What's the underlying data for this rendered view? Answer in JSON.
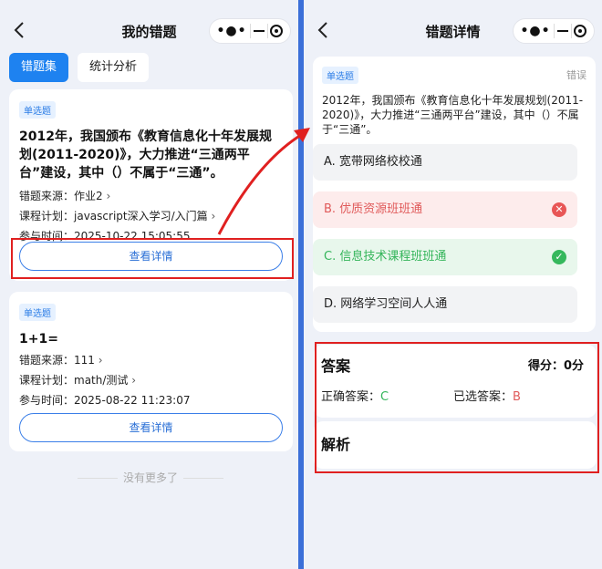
{
  "left": {
    "nav_title": "我的错题",
    "tabs": [
      "错题集",
      "统计分析"
    ],
    "cards": [
      {
        "badge": "单选题",
        "title": "2012年，我国颁布《教育信息化十年发展规划(2011-2020)》，大力推进“三通两平台”建设，其中（）不属于“三通”。",
        "source_label": "错题来源：",
        "source": "作业2",
        "plan_label": "课程计划：",
        "plan": "javascript深入学习/入门篇",
        "time_label": "参与时间：",
        "time": "2025-10-22 15:05:55",
        "button": "查看详情"
      },
      {
        "badge": "单选题",
        "title": "1+1=",
        "source_label": "错题来源：",
        "source": "111",
        "plan_label": "课程计划：",
        "plan": "math/测试",
        "time_label": "参与时间：",
        "time": "2025-08-22 11:23:07",
        "button": "查看详情"
      }
    ],
    "no_more": "没有更多了"
  },
  "right": {
    "nav_title": "错题详情",
    "badge": "单选题",
    "status": "错误",
    "stem": "2012年，我国颁布《教育信息化十年发展规划(2011-2020)》，大力推进“三通两平台”建设，其中（）不属于“三通”。",
    "options": [
      {
        "text": "A.  宽带网络校校通",
        "state": "normal"
      },
      {
        "text": "B.  优质资源班班通",
        "state": "wrong"
      },
      {
        "text": "C.  信息技术课程班班通",
        "state": "right"
      },
      {
        "text": "D.  网络学习空间人人通",
        "state": "normal"
      }
    ],
    "answer_heading": "答案",
    "score": "得分：0分",
    "correct_label": "正确答案：",
    "correct_value": "C",
    "selected_label": "已选答案：",
    "selected_value": "B",
    "analysis_heading": "解析"
  },
  "colors": {
    "accent": "#1e82f0",
    "highlight": "#e02020",
    "correct": "#34b55a",
    "wrong": "#e05a5a"
  }
}
